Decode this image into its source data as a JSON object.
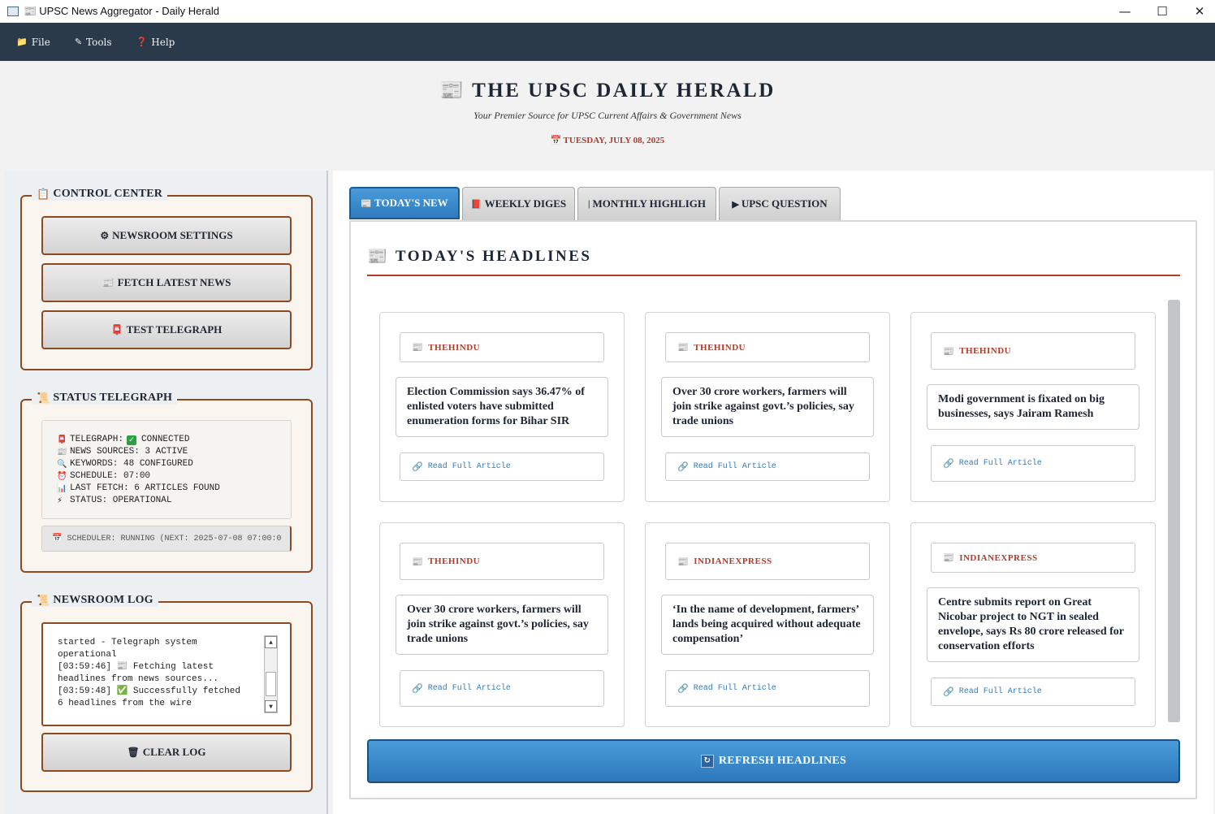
{
  "window": {
    "title": "UPSC News Aggregator - Daily Herald",
    "title_icon": "📰",
    "minimize": "—",
    "maximize": "☐",
    "close": "✕"
  },
  "menu": [
    {
      "icon": "📁",
      "label": "File"
    },
    {
      "icon": "✎",
      "label": "Tools"
    },
    {
      "icon": "❓",
      "label": "Help"
    }
  ],
  "header": {
    "icon": "📰",
    "title": "THE UPSC DAILY HERALD",
    "tagline": "Your Premier Source for UPSC Current Affairs & Government News",
    "date_icon": "📅",
    "date": "TUESDAY, JULY 08, 2025"
  },
  "control_center": {
    "icon": "📋",
    "title": "CONTROL CENTER",
    "buttons": [
      {
        "icon": "⚙",
        "label": "NEWSROOM SETTINGS"
      },
      {
        "icon": "📰",
        "label": "FETCH LATEST NEWS"
      },
      {
        "icon": "📮",
        "label": "TEST TELEGRAPH"
      }
    ]
  },
  "status_telegraph": {
    "icon": "📜",
    "title": "STATUS TELEGRAPH",
    "lines": [
      {
        "icon": "📮",
        "label": "TELEGRAPH:",
        "check": "✓",
        "value": "CONNECTED"
      },
      {
        "icon": "📰",
        "label": "NEWS SOURCES: 3 ACTIVE"
      },
      {
        "icon": "🔍",
        "label": "KEYWORDS: 48 CONFIGURED"
      },
      {
        "icon": "⏰",
        "label": "SCHEDULE: 07:00"
      },
      {
        "icon": "📊",
        "label": "LAST FETCH: 6 ARTICLES FOUND"
      },
      {
        "icon": "⚡",
        "label": "STATUS: OPERATIONAL"
      }
    ],
    "scheduler_icon": "📅",
    "scheduler": "SCHEDULER: RUNNING (NEXT: 2025-07-08 07:00:0"
  },
  "newsroom_log": {
    "icon": "📜",
    "title": "NEWSROOM LOG",
    "lines": [
      "started - Telegraph system",
      "operational",
      "[03:59:46] 📰 Fetching latest",
      "headlines from news sources...",
      "[03:59:48] ✅ Successfully fetched",
      "6 headlines from the wire"
    ],
    "scroll_up": "▲",
    "scroll_down": "▼",
    "clear_icon": "🗑",
    "clear_label": "CLEAR LOG"
  },
  "tabs": [
    {
      "icon": "📰",
      "label": "TODAY'S NEW",
      "active": true
    },
    {
      "icon": "📕",
      "label": "WEEKLY DIGES",
      "active": false
    },
    {
      "icon": "|",
      "label": "MONTHLY HIGHLIGH",
      "active": false
    },
    {
      "icon": "▶",
      "label": "UPSC QUESTION",
      "active": false
    }
  ],
  "headlines": {
    "icon": "📰",
    "title": "TODAY'S HEADLINES",
    "read_icon": "🔗",
    "source_icon": "📰",
    "articles": [
      {
        "source": "THEHINDU",
        "headline": "Election Commission says 36.47% of enlisted voters have submitted enumeration forms for Bihar SIR",
        "link": "Read Full Article"
      },
      {
        "source": "THEHINDU",
        "headline": "Over 30 crore workers, farmers will join strike against govt.’s policies, say trade unions",
        "link": "Read Full Article"
      },
      {
        "source": "THEHINDU",
        "headline": "Modi government is fixated on big businesses, says Jairam Ramesh",
        "link": "Read Full Article"
      },
      {
        "source": "THEHINDU",
        "headline": "Over 30 crore workers, farmers will join strike against govt.’s policies, say trade unions",
        "link": "Read Full Article"
      },
      {
        "source": "INDIANEXPRESS",
        "headline": "‘In the name of development, farmers’ lands being acquired without adequate compensation’",
        "link": "Read Full Article"
      },
      {
        "source": "INDIANEXPRESS",
        "headline": "Centre submits report on Great Nicobar project to NGT in sealed envelope, says Rs 80 crore released for conservation efforts",
        "link": "Read Full Article"
      }
    ],
    "refresh_icon": "↻",
    "refresh_label": "REFRESH HEADLINES"
  }
}
